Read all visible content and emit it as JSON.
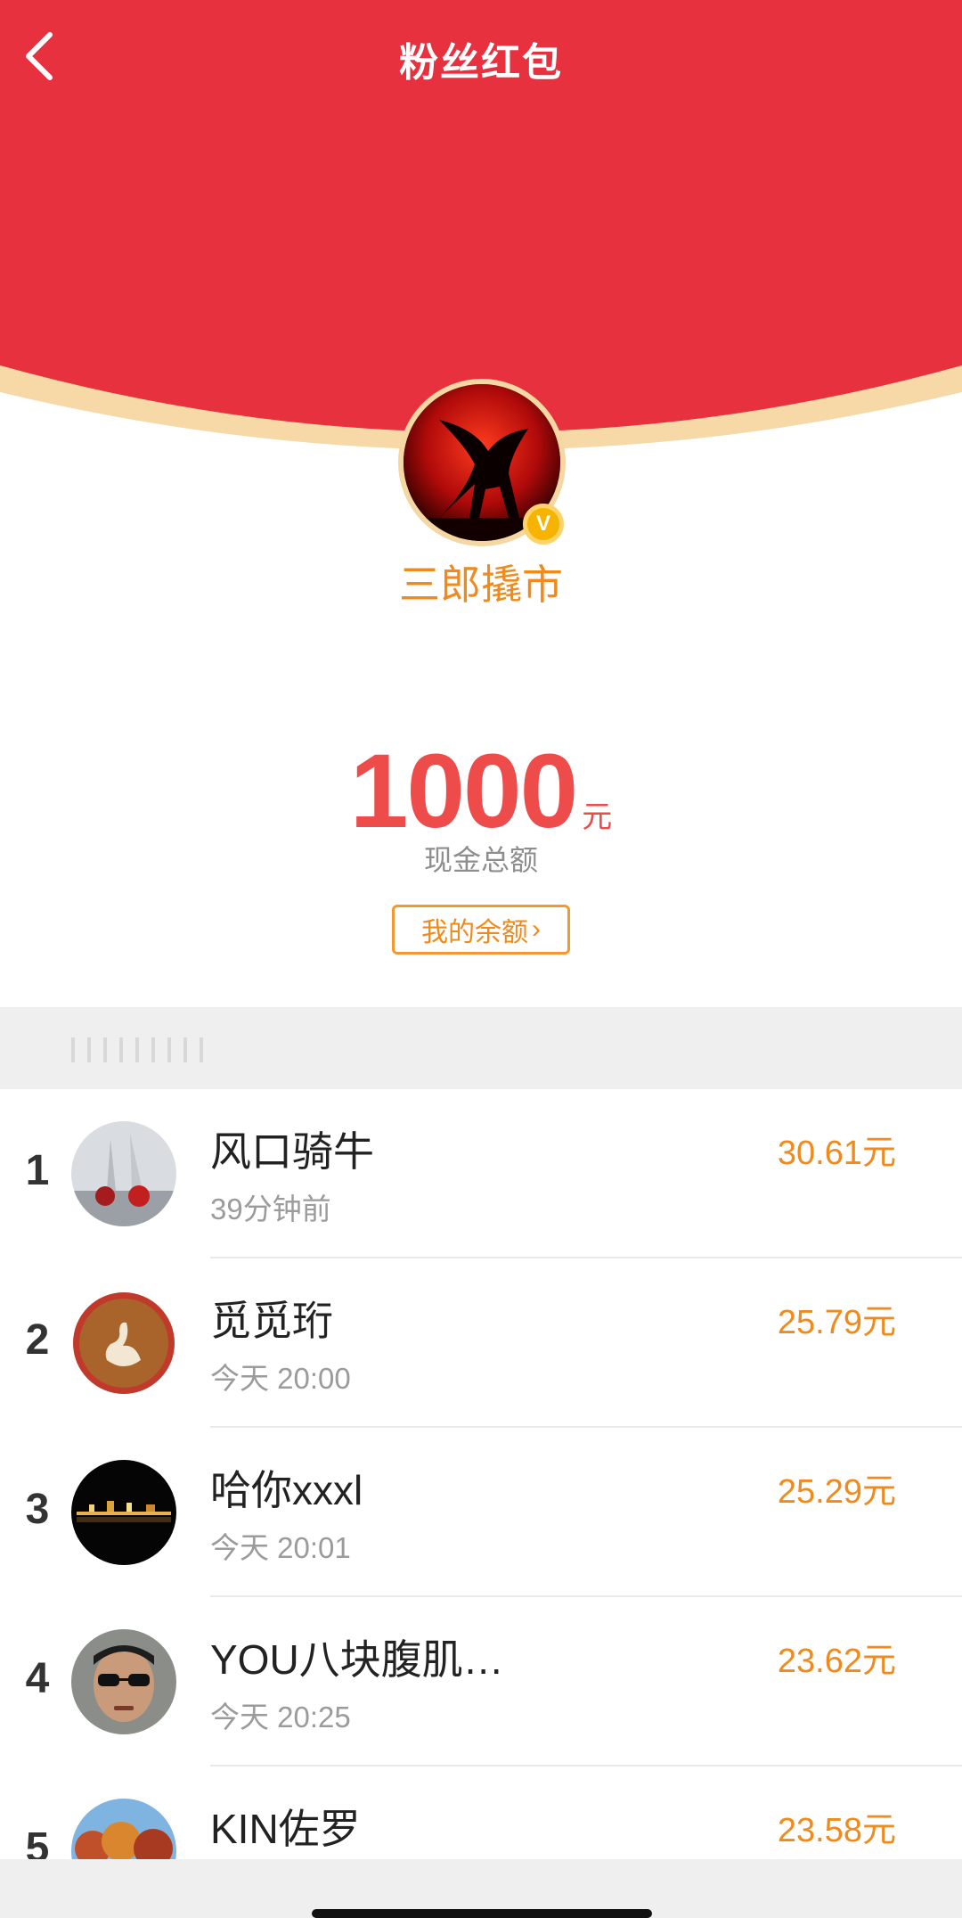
{
  "header": {
    "title": "粉丝红包",
    "back_icon": "chevron-left-icon"
  },
  "owner": {
    "name": "三郎撬市",
    "verified_icon": "v-verified-icon",
    "verified_label": "V"
  },
  "summary": {
    "amount": "1000",
    "unit": "元",
    "label": "现金总额",
    "balance_button": "我的余额",
    "balance_chevron": "›"
  },
  "colors": {
    "red": "#e7313f",
    "accent_orange": "#f08a1c",
    "amount_red": "#ee4b4b",
    "gold_edge": "#f4d7a2"
  },
  "records": [
    {
      "rank": "1",
      "name": "风口骑牛",
      "time": "39分钟前",
      "amount": "30.61元",
      "avatar": "statue-red-apples-avatar"
    },
    {
      "rank": "2",
      "name": "觅觅珩",
      "time": "今天 20:00",
      "amount": "25.79元",
      "avatar": "latte-art-swan-avatar"
    },
    {
      "rank": "3",
      "name": "哈你xxxl",
      "time": "今天 20:01",
      "amount": "25.29元",
      "avatar": "night-city-avatar"
    },
    {
      "rank": "4",
      "name": "YOU八块腹肌…",
      "time": "今天 20:25",
      "amount": "23.62元",
      "avatar": "man-sunglasses-avatar"
    },
    {
      "rank": "5",
      "name": "KIN佐罗",
      "time": "",
      "amount": "23.58元",
      "avatar": "autumn-trees-avatar"
    }
  ]
}
